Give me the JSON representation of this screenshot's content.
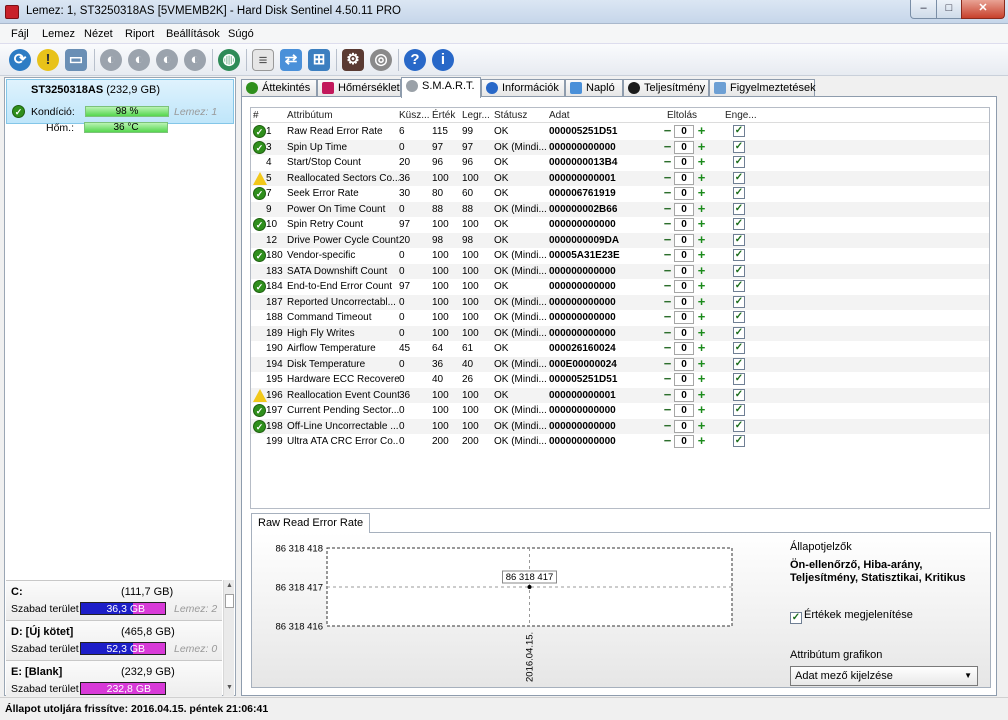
{
  "window": {
    "title": "Lemez: 1, ST3250318AS [5VMEMB2K]  -  Hard Disk Sentinel 4.50.11 PRO",
    "min": "–",
    "max": "□",
    "close": "✕"
  },
  "menu": [
    "Fájl",
    "Lemez",
    "Nézet",
    "Riport",
    "Beállítások",
    "Súgó"
  ],
  "disk": {
    "name": "ST3250318AS",
    "size": "(232,9 GB)",
    "health_label": "Kondíció:",
    "health_value": "98 %",
    "health_pct": 98,
    "lemez": "Lemez: 1",
    "temp_label": "Hőm.:",
    "temp_value": "36 °C"
  },
  "partitions": [
    {
      "name": "C:",
      "size": "(111,7 GB)",
      "free_label": "Szabad terület",
      "free": "36,3 GB",
      "lemez": "Lemez: 2"
    },
    {
      "name": "D: [Új kötet]",
      "size": "(465,8 GB)",
      "free_label": "Szabad terület",
      "free": "52,3 GB",
      "lemez": "Lemez: 0"
    },
    {
      "name": "E: [Blank]",
      "size": "(232,9 GB)",
      "free_label": "Szabad terület",
      "free": "232,8 GB",
      "lemez": ""
    }
  ],
  "tabs": [
    "Áttekintés",
    "Hőmérséklet",
    "S.M.A.R.T.",
    "Információk",
    "Napló",
    "Teljesítmény",
    "Figyelmeztetések"
  ],
  "columns": {
    "num": "#",
    "attr": "Attribútum",
    "thr": "Küsz...",
    "val": "Érték",
    "worst": "Legr...",
    "status": "Státusz",
    "data": "Adat",
    "offset": "Eltolás",
    "enable": "Enge..."
  },
  "rows": [
    {
      "mark": "ok",
      "num": "1",
      "attr": "Raw Read Error Rate",
      "thr": "6",
      "val": "115",
      "worst": "99",
      "status": "OK",
      "data": "000005251D51",
      "offset": "0"
    },
    {
      "mark": "ok",
      "num": "3",
      "attr": "Spin Up Time",
      "thr": "0",
      "val": "97",
      "worst": "97",
      "status": "OK (Mindi...",
      "data": "000000000000",
      "offset": "0"
    },
    {
      "mark": "",
      "num": "4",
      "attr": "Start/Stop Count",
      "thr": "20",
      "val": "96",
      "worst": "96",
      "status": "OK",
      "data": "0000000013B4",
      "offset": "0"
    },
    {
      "mark": "warn",
      "num": "5",
      "attr": "Reallocated Sectors Co...",
      "thr": "36",
      "val": "100",
      "worst": "100",
      "status": "OK",
      "data": "000000000001",
      "offset": "0"
    },
    {
      "mark": "ok",
      "num": "7",
      "attr": "Seek Error Rate",
      "thr": "30",
      "val": "80",
      "worst": "60",
      "status": "OK",
      "data": "000006761919",
      "offset": "0"
    },
    {
      "mark": "",
      "num": "9",
      "attr": "Power On Time Count",
      "thr": "0",
      "val": "88",
      "worst": "88",
      "status": "OK (Mindi...",
      "data": "000000002B66",
      "offset": "0"
    },
    {
      "mark": "ok",
      "num": "10",
      "attr": "Spin Retry Count",
      "thr": "97",
      "val": "100",
      "worst": "100",
      "status": "OK",
      "data": "000000000000",
      "offset": "0"
    },
    {
      "mark": "",
      "num": "12",
      "attr": "Drive Power Cycle Count",
      "thr": "20",
      "val": "98",
      "worst": "98",
      "status": "OK",
      "data": "0000000009DA",
      "offset": "0"
    },
    {
      "mark": "ok",
      "num": "180",
      "attr": "Vendor-specific",
      "thr": "0",
      "val": "100",
      "worst": "100",
      "status": "OK (Mindi...",
      "data": "00005A31E23E",
      "offset": "0"
    },
    {
      "mark": "",
      "num": "183",
      "attr": "SATA Downshift Count",
      "thr": "0",
      "val": "100",
      "worst": "100",
      "status": "OK (Mindi...",
      "data": "000000000000",
      "offset": "0"
    },
    {
      "mark": "ok",
      "num": "184",
      "attr": "End-to-End Error Count",
      "thr": "97",
      "val": "100",
      "worst": "100",
      "status": "OK",
      "data": "000000000000",
      "offset": "0"
    },
    {
      "mark": "",
      "num": "187",
      "attr": "Reported Uncorrectabl...",
      "thr": "0",
      "val": "100",
      "worst": "100",
      "status": "OK (Mindi...",
      "data": "000000000000",
      "offset": "0"
    },
    {
      "mark": "",
      "num": "188",
      "attr": "Command Timeout",
      "thr": "0",
      "val": "100",
      "worst": "100",
      "status": "OK (Mindi...",
      "data": "000000000000",
      "offset": "0"
    },
    {
      "mark": "",
      "num": "189",
      "attr": "High Fly Writes",
      "thr": "0",
      "val": "100",
      "worst": "100",
      "status": "OK (Mindi...",
      "data": "000000000000",
      "offset": "0"
    },
    {
      "mark": "",
      "num": "190",
      "attr": "Airflow Temperature",
      "thr": "45",
      "val": "64",
      "worst": "61",
      "status": "OK",
      "data": "000026160024",
      "offset": "0"
    },
    {
      "mark": "",
      "num": "194",
      "attr": "Disk Temperature",
      "thr": "0",
      "val": "36",
      "worst": "40",
      "status": "OK (Mindi...",
      "data": "000E00000024",
      "offset": "0"
    },
    {
      "mark": "",
      "num": "195",
      "attr": "Hardware ECC Recovered",
      "thr": "0",
      "val": "40",
      "worst": "26",
      "status": "OK (Mindi...",
      "data": "000005251D51",
      "offset": "0"
    },
    {
      "mark": "warn",
      "num": "196",
      "attr": "Reallocation Event Count",
      "thr": "36",
      "val": "100",
      "worst": "100",
      "status": "OK",
      "data": "000000000001",
      "offset": "0"
    },
    {
      "mark": "ok",
      "num": "197",
      "attr": "Current Pending Sector...",
      "thr": "0",
      "val": "100",
      "worst": "100",
      "status": "OK (Mindi...",
      "data": "000000000000",
      "offset": "0"
    },
    {
      "mark": "ok",
      "num": "198",
      "attr": "Off-Line Uncorrectable ...",
      "thr": "0",
      "val": "100",
      "worst": "100",
      "status": "OK (Mindi...",
      "data": "000000000000",
      "offset": "0"
    },
    {
      "mark": "",
      "num": "199",
      "attr": "Ultra ATA CRC Error Co...",
      "thr": "0",
      "val": "200",
      "worst": "200",
      "status": "OK (Mindi...",
      "data": "000000000000",
      "offset": "0"
    }
  ],
  "chart": {
    "tab": "Raw Read Error Rate"
  },
  "chart_data": {
    "type": "scatter",
    "y_ticks": [
      "86 318 418",
      "86 318 417",
      "86 318 416"
    ],
    "ylim": [
      86318416,
      86318418
    ],
    "x": [
      "2016.04.15."
    ],
    "y": [
      86318417
    ],
    "point_label": "86 318 417"
  },
  "side": {
    "state_title": "Állapotjelzők",
    "state_desc": "Ön-ellenőrző, Hiba-arány, Teljesítmény, Statisztikai, Kritikus",
    "show_values": "Értékek megjelenítése",
    "attr_graph": "Attribútum grafikon",
    "select_value": "Adat mező kijelzése"
  },
  "status": "Állapot utoljára frissítve: 2016.04.15. péntek 21:06:41",
  "icons": [
    "refresh-icon",
    "warning-icon",
    "drive-icon",
    "disk-icon",
    "network-icon",
    "globe-icon",
    "report-icon",
    "settings-icon",
    "help-icon",
    "info-icon"
  ]
}
